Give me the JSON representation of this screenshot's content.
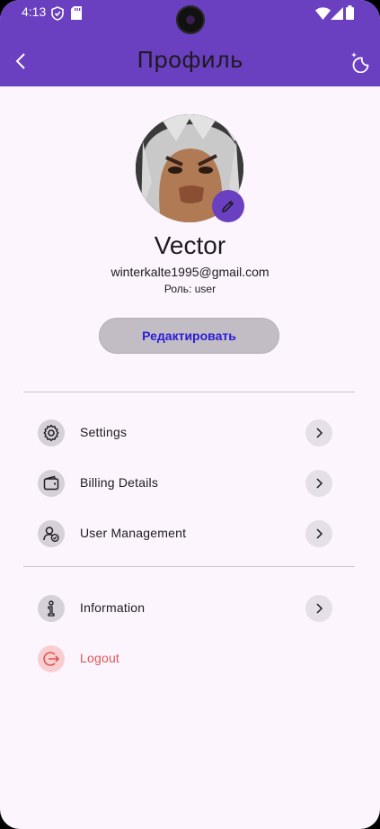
{
  "status_bar": {
    "time": "4:13"
  },
  "app_bar": {
    "title": "Профиль",
    "color": "#6a3fc0"
  },
  "profile": {
    "name": "Vector",
    "email": "winterkalte1995@gmail.com",
    "role": "Роль: user",
    "edit_button": "Редактировать"
  },
  "menu": {
    "settings": "Settings",
    "billing": "Billing Details",
    "user_management": "User Management",
    "information": "Information",
    "logout": "Logout"
  },
  "colors": {
    "background": "#fcf5fe",
    "accent": "#6a3fc0",
    "logout": "#e35454",
    "edit_button_text": "#2a1bd8"
  }
}
